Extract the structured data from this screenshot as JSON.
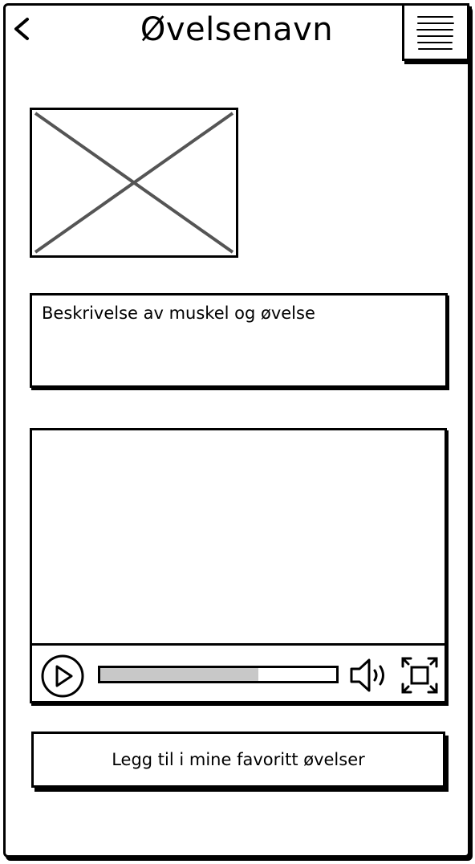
{
  "header": {
    "title": "Øvelsenavn",
    "back_icon": "chevron-left-icon",
    "menu_icon": "hamburger-menu-icon"
  },
  "image": {
    "icon": "image-placeholder-icon"
  },
  "description": {
    "text": "Beskrivelse av muskel og øvelse"
  },
  "video_player": {
    "play_icon": "play-icon",
    "progress": 0.67,
    "volume_icon": "volume-icon",
    "fullscreen_icon": "fullscreen-icon"
  },
  "favorite_button": {
    "label": "Legg til i mine favoritt øvelser"
  }
}
